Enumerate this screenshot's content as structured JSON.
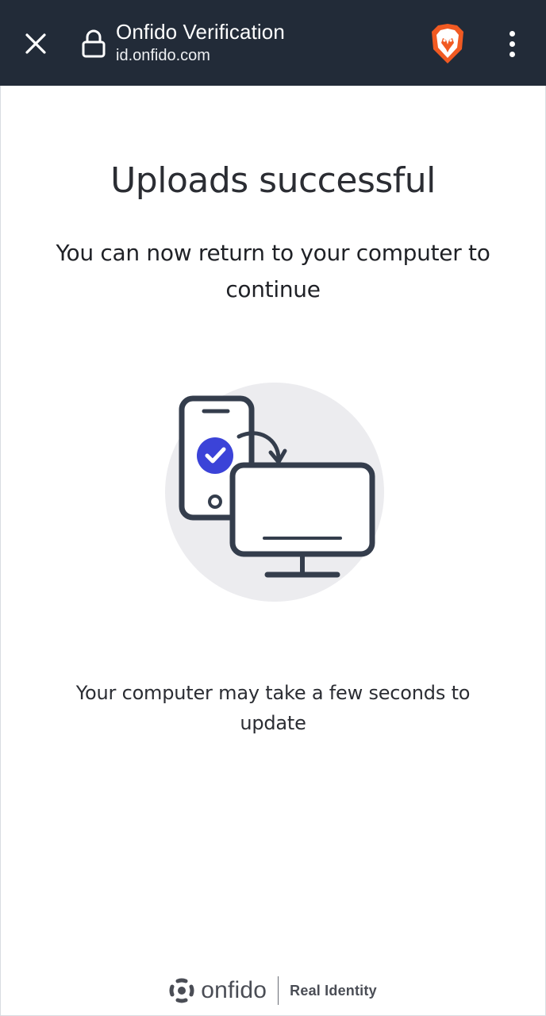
{
  "browser": {
    "title": "Onfido Verification",
    "url": "id.onfido.com",
    "icons": {
      "close": "close-icon",
      "lock": "lock-icon",
      "brave": "brave-lion-icon",
      "menu": "more-vert-icon"
    },
    "colors": {
      "bar": "#222b38",
      "brave": "#f15a22"
    }
  },
  "main": {
    "heading": "Uploads successful",
    "subheading": "You can now return to your computer to continue",
    "illustration": "phone-to-computer-illustration",
    "body": "Your computer may take a few seconds to update"
  },
  "footer": {
    "brand": "onfido",
    "tagline": "Real Identity"
  },
  "colors": {
    "accent": "#3b43d8",
    "circle": "#ececef",
    "illustration_stroke": "#343d4c"
  }
}
